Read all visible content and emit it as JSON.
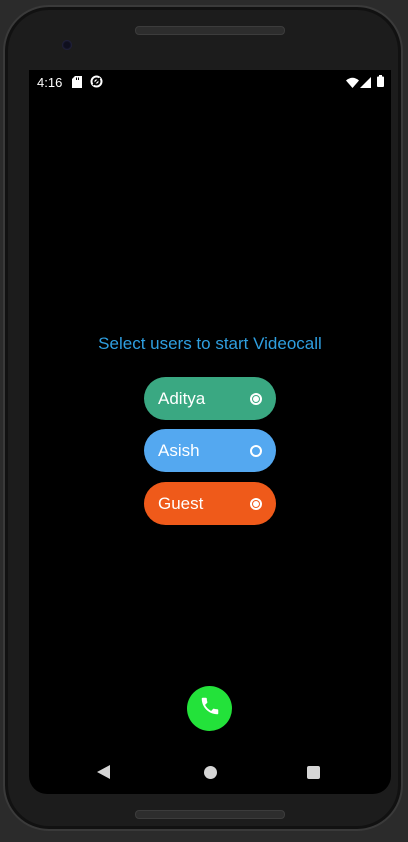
{
  "status_bar": {
    "time": "4:16"
  },
  "main": {
    "title": "Select users to start Videocall",
    "users": [
      {
        "name": "Aditya",
        "color": "#3aa882",
        "selected": true
      },
      {
        "name": "Asish",
        "color": "#54a8f0",
        "selected": false
      },
      {
        "name": "Guest",
        "color": "#ef5a1a",
        "selected": true
      }
    ]
  },
  "call_button": {
    "icon": "phone-icon",
    "color": "#23e23a"
  },
  "icons": {
    "status": [
      "sd-card-icon",
      "sync-icon",
      "wifi-icon",
      "signal-icon",
      "battery-icon"
    ],
    "nav": [
      "back-icon",
      "home-icon",
      "recents-icon"
    ]
  }
}
